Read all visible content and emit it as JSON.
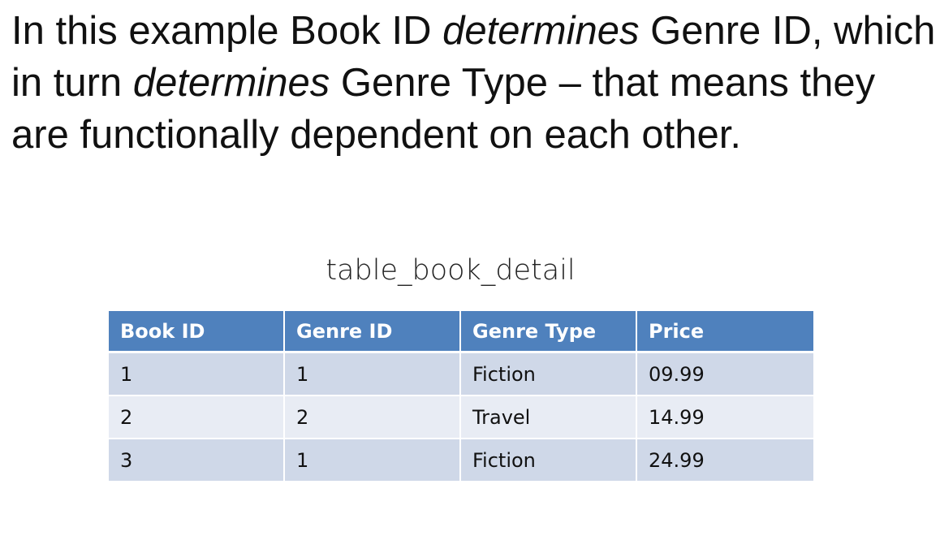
{
  "heading": {
    "part1": "In this example Book ID ",
    "italic1": "determines",
    "part2": " Genre ID, which in turn ",
    "italic2": "determines",
    "part3": " Genre Type – that means they are functionally dependent on each other."
  },
  "table": {
    "title": "table_book_detail",
    "headers": [
      "Book ID",
      "Genre ID",
      "Genre Type",
      "Price"
    ],
    "rows": [
      [
        "1",
        "1",
        "Fiction",
        "09.99"
      ],
      [
        "2",
        "2",
        "Travel",
        "14.99"
      ],
      [
        "3",
        "1",
        "Fiction",
        "24.99"
      ]
    ]
  }
}
